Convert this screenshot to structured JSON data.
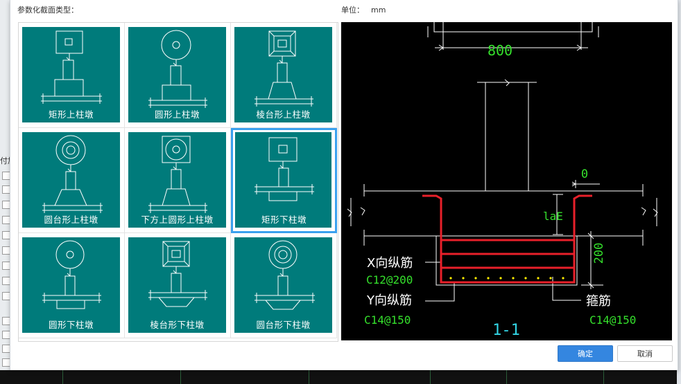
{
  "dialog": {
    "section_type_label": "参数化截面类型：",
    "unit_label": "单位：",
    "unit_value": "mm",
    "side_label": "付加",
    "ok_label": "确定",
    "cancel_label": "取消"
  },
  "tiles": [
    {
      "label": "矩形上柱墩"
    },
    {
      "label": "圆形上柱墩"
    },
    {
      "label": "棱台形上柱墩"
    },
    {
      "label": "圆台形上柱墩"
    },
    {
      "label": "下方上圆形上柱墩"
    },
    {
      "label": "矩形下柱墩",
      "selected": true
    },
    {
      "label": "圆形下柱墩"
    },
    {
      "label": "棱台形下柱墩"
    },
    {
      "label": "圆台形下柱墩"
    }
  ],
  "preview": {
    "dim_top": "800",
    "dim_offset": "0",
    "dim_anchor": "laE",
    "dim_height": "200",
    "x_rebar_label": "X向纵筋",
    "x_rebar_value": "C12@200",
    "y_rebar_label": "Y向纵筋",
    "y_rebar_value": "C14@150",
    "stirrup_label": "箍筋",
    "stirrup_value": "C14@150",
    "section_name": "1-1",
    "colors": {
      "rebar": "#e8202a",
      "dim_text": "#35e02c",
      "label_text": "#ffffff",
      "section_text": "#33d6e6",
      "dots": "#ffee00"
    }
  }
}
